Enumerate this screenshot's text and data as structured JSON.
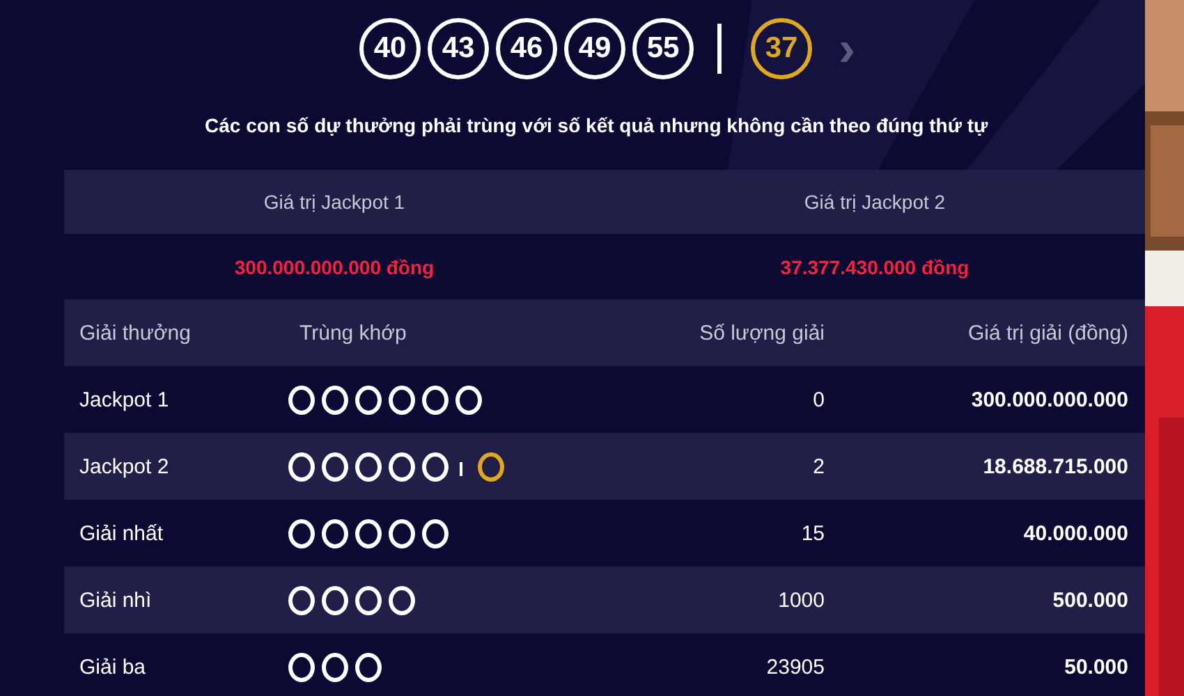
{
  "draw": {
    "balls": [
      {
        "number": "40",
        "kind": "main"
      },
      {
        "number": "43",
        "kind": "main"
      },
      {
        "number": "46",
        "kind": "main"
      },
      {
        "number": "49",
        "kind": "main"
      },
      {
        "number": "55",
        "kind": "main"
      },
      {
        "number": "37",
        "kind": "bonus"
      }
    ],
    "next": "›",
    "note": "Các con số dự thưởng phải trùng với số kết quả nhưng không cần theo đúng thứ tự"
  },
  "jackpots": [
    {
      "label": "Giá trị Jackpot 1",
      "value": "300.000.000.000 đồng"
    },
    {
      "label": "Giá trị Jackpot 2",
      "value": "37.377.430.000 đồng"
    }
  ],
  "table": {
    "columns": [
      "Giải thưởng",
      "Trùng khớp",
      "Số lượng giải",
      "Giá trị giải (đồng)"
    ],
    "rows": [
      {
        "prize": "Jackpot 1",
        "match": [
          {
            "kind": "main"
          },
          {
            "kind": "main"
          },
          {
            "kind": "main"
          },
          {
            "kind": "main"
          },
          {
            "kind": "main"
          },
          {
            "kind": "main"
          }
        ],
        "count": "0",
        "value": "300.000.000.000"
      },
      {
        "prize": "Jackpot 2",
        "match": [
          {
            "kind": "main"
          },
          {
            "kind": "main"
          },
          {
            "kind": "main"
          },
          {
            "kind": "main"
          },
          {
            "kind": "main"
          },
          {
            "kind": "bonus"
          }
        ],
        "count": "2",
        "value": "18.688.715.000"
      },
      {
        "prize": "Giải nhất",
        "match": [
          {
            "kind": "main"
          },
          {
            "kind": "main"
          },
          {
            "kind": "main"
          },
          {
            "kind": "main"
          },
          {
            "kind": "main"
          }
        ],
        "count": "15",
        "value": "40.000.000"
      },
      {
        "prize": "Giải nhì",
        "match": [
          {
            "kind": "main"
          },
          {
            "kind": "main"
          },
          {
            "kind": "main"
          },
          {
            "kind": "main"
          }
        ],
        "count": "1000",
        "value": "500.000"
      },
      {
        "prize": "Giải ba",
        "match": [
          {
            "kind": "main"
          },
          {
            "kind": "main"
          },
          {
            "kind": "main"
          }
        ],
        "count": "23905",
        "value": "50.000"
      }
    ]
  }
}
